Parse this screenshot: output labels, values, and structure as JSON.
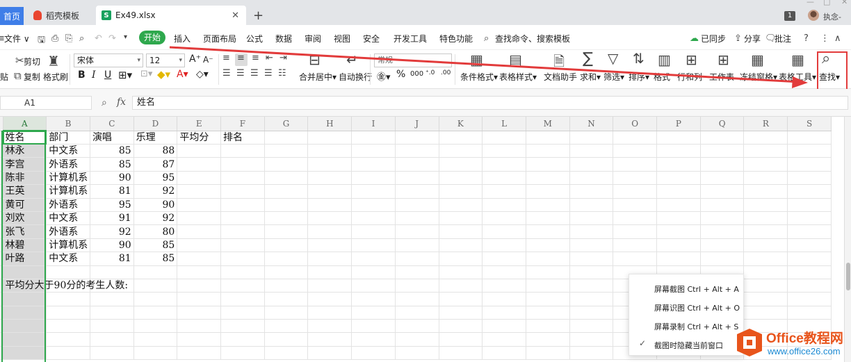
{
  "tabs": {
    "home": "首页",
    "template": "稻壳模板",
    "file": "Ex49.xlsx",
    "file_icon": "S"
  },
  "user": {
    "badge": "1",
    "name": "执念-"
  },
  "menu": {
    "file": "文件",
    "items": [
      "开始",
      "插入",
      "页面布局",
      "公式",
      "数据",
      "审阅",
      "视图",
      "安全",
      "开发工具",
      "特色功能"
    ],
    "search": "查找命令、搜索模板",
    "sync": "已同步",
    "share": "分享",
    "comment": "批注"
  },
  "ribbon": {
    "cut": "剪切",
    "copy": "复制",
    "paste_frag": "贴",
    "format_painter": "格式刷",
    "font_name": "宋体",
    "font_size": "12",
    "merge": "合并居中",
    "wrap": "自动换行",
    "number_format": "常规",
    "cond_format": "条件格式",
    "table_style": "表格样式",
    "doc_helper": "文档助手",
    "sum": "求和",
    "filter": "筛选",
    "sort": "排序",
    "format": "格式",
    "row_col": "行和列",
    "worksheet": "工作表",
    "freeze": "冻结窗格",
    "table_tools": "表格工具",
    "find": "查找"
  },
  "formula_bar": {
    "cell_ref": "A1",
    "fx": "fx",
    "value": "姓名"
  },
  "columns": [
    "A",
    "B",
    "C",
    "D",
    "E",
    "F",
    "G",
    "H",
    "I",
    "J",
    "K",
    "L",
    "M",
    "N",
    "O",
    "P",
    "Q",
    "R",
    "S"
  ],
  "rows": [
    [
      "姓名",
      "部门",
      "演唱",
      "乐理",
      "平均分",
      "排名"
    ],
    [
      "林永",
      "中文系",
      "85",
      "88",
      "",
      ""
    ],
    [
      "李宫",
      "外语系",
      "85",
      "87",
      "",
      ""
    ],
    [
      "陈非",
      "计算机系",
      "90",
      "95",
      "",
      ""
    ],
    [
      "王英",
      "计算机系",
      "81",
      "92",
      "",
      ""
    ],
    [
      "黄可",
      "外语系",
      "95",
      "90",
      "",
      ""
    ],
    [
      "刘欢",
      "中文系",
      "91",
      "92",
      "",
      ""
    ],
    [
      "张飞",
      "外语系",
      "92",
      "80",
      "",
      ""
    ],
    [
      "林碧",
      "计算机系",
      "90",
      "85",
      "",
      ""
    ],
    [
      "叶路",
      "中文系",
      "81",
      "85",
      "",
      ""
    ],
    [
      "",
      "",
      "",
      "",
      "",
      ""
    ],
    [
      "平均分大于90分的考生人数:",
      "",
      "",
      "",
      "",
      ""
    ]
  ],
  "context_menu": {
    "items": [
      "屏幕截图 Ctrl + Alt + A",
      "屏幕识图 Ctrl + Alt + O",
      "屏幕录制 Ctrl + Alt + S",
      "截图时隐藏当前窗口"
    ]
  },
  "watermark": {
    "title": "Office教程网",
    "url": "www.office26.com"
  },
  "colors": {
    "accent": "#2ea84d",
    "annotation": "#e23b3b",
    "tab_home": "#3f7ee8"
  }
}
